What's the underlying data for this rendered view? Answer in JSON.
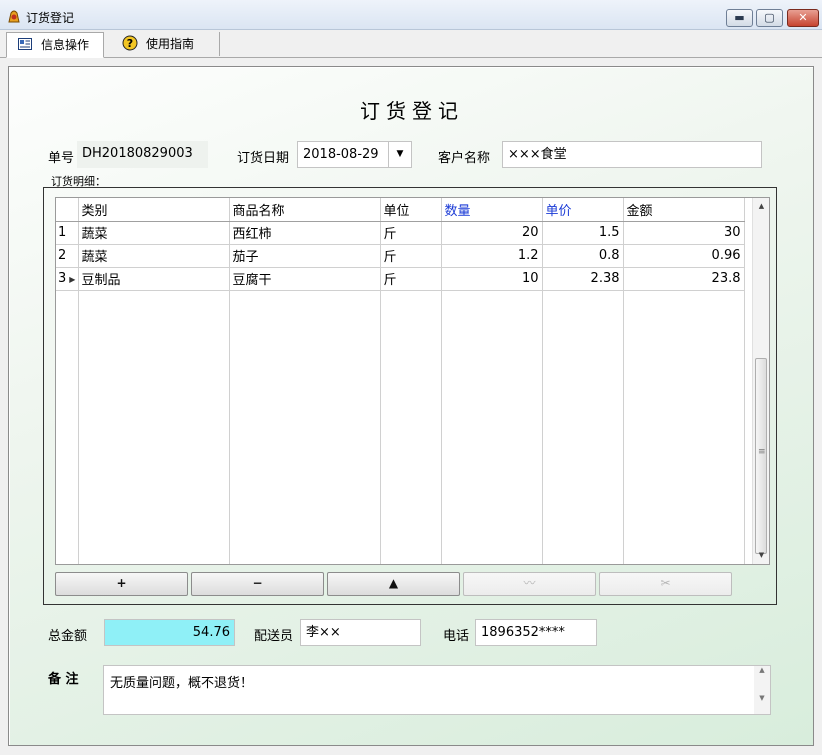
{
  "window": {
    "title": "订货登记",
    "minimize_glyph": "▬",
    "maximize_glyph": "▢",
    "close_glyph": "✕"
  },
  "tabs": [
    {
      "label": "信息操作",
      "icon": "info-card-icon",
      "active": true
    },
    {
      "label": "使用指南",
      "icon": "help-icon",
      "active": false
    }
  ],
  "form": {
    "title": "订货登记",
    "order_no_label": "单号",
    "order_no_value": "DH20180829003",
    "order_date_label": "订货日期",
    "order_date_value": "2018-08-29",
    "customer_label": "客户名称",
    "customer_value": "×××食堂",
    "details_label": "订货明细："
  },
  "grid": {
    "columns": [
      {
        "label": "类别",
        "highlight": false
      },
      {
        "label": "商品名称",
        "highlight": false
      },
      {
        "label": "单位",
        "highlight": false
      },
      {
        "label": "数量",
        "highlight": true
      },
      {
        "label": "单价",
        "highlight": true
      },
      {
        "label": "金额",
        "highlight": false
      }
    ],
    "rows": [
      {
        "index": "1",
        "category": "蔬菜",
        "name": "西红柿",
        "unit": "斤",
        "qty": "20",
        "price": "1.5",
        "amount": "30",
        "current": false
      },
      {
        "index": "2",
        "category": "蔬菜",
        "name": "茄子",
        "unit": "斤",
        "qty": "1.2",
        "price": "0.8",
        "amount": "0.96",
        "current": false
      },
      {
        "index": "3",
        "category": "豆制品",
        "name": "豆腐干",
        "unit": "斤",
        "qty": "10",
        "price": "2.38",
        "amount": "23.8",
        "current": true
      }
    ],
    "buttons": [
      {
        "glyph": "+",
        "name": "add-row-button",
        "enabled": true
      },
      {
        "glyph": "−",
        "name": "delete-row-button",
        "enabled": true
      },
      {
        "glyph": "▲",
        "name": "move-up-button",
        "enabled": true
      },
      {
        "glyph": "〰",
        "name": "confirm-edit-button",
        "enabled": false
      },
      {
        "glyph": "✂",
        "name": "cancel-edit-button",
        "enabled": false
      }
    ]
  },
  "footer": {
    "total_label": "总金额",
    "total_value": "54.76",
    "courier_label": "配送员",
    "courier_value": "李××",
    "phone_label": "电话",
    "phone_value": "1896352****",
    "memo_label": "备 注",
    "memo_value": "无质量问题，概不退货！"
  },
  "colors": {
    "total_highlight": "#8ff0f7",
    "column_highlight": "#1a3ad6",
    "panel_gradient_end": "#d8eddc"
  }
}
